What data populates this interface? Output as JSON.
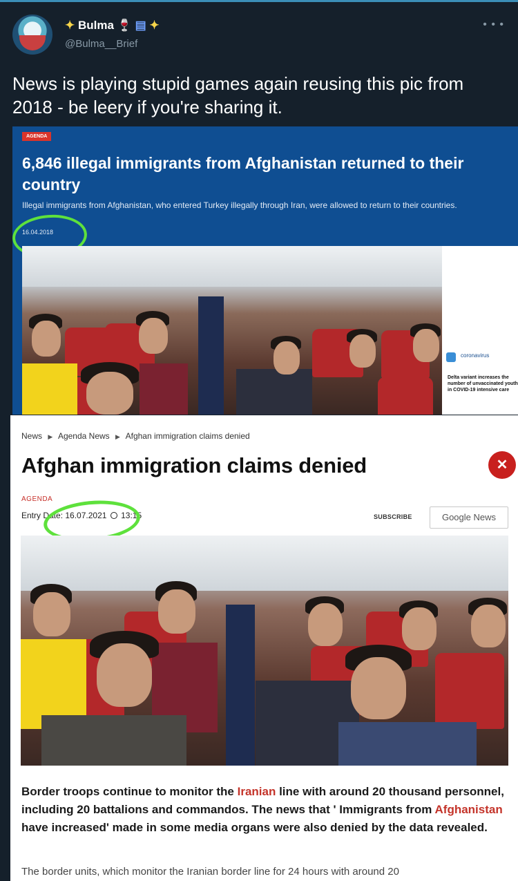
{
  "tweet": {
    "display_name": "Bulma",
    "handle": "@Bulma__Brief",
    "text": "News is playing stupid games again reusing this pic from 2018 - be leery if you're sharing it."
  },
  "article_2018": {
    "badge": "AGENDA",
    "headline": "6,846 illegal immigrants from Afghanistan returned to their country",
    "subheadline": "Illegal immigrants from Afghanistan, who entered Turkey illegally through Iran, were allowed to return to their countries.",
    "date": "16.04.2018",
    "side_tag": "coronavirus",
    "side_promo": "Delta variant increases the number of unvaccinated youth in COVID-19 intensive care"
  },
  "article_2021": {
    "breadcrumb": [
      "News",
      "Agenda News",
      "Afghan immigration claims denied"
    ],
    "headline": "Afghan immigration claims denied",
    "close_label": "✕",
    "category": "AGENDA",
    "entry_label": "Entry Date: ",
    "entry_date": "16.07.2021",
    "entry_time": "13:15",
    "subscribe_label": "SUBSCRIBE",
    "google_news_label": "Google News",
    "body_part1": "Border troops continue to monitor the ",
    "body_hl1": "Iranian",
    "body_part2": " line with around 20 thousand personnel, including 20 battalions and commandos. The news that ' Immigrants from ",
    "body_hl2": "Afghanistan",
    "body_part3": " have increased' made in some media organs were also denied by the data revealed.",
    "body_next": "The border units, which monitor the Iranian border line for 24 hours with around 20"
  },
  "colors": {
    "tweet_bg": "#15202b",
    "card_blue": "#0f4e92",
    "accent_red": "#c4342a",
    "annotation_green": "#5ee13c"
  }
}
